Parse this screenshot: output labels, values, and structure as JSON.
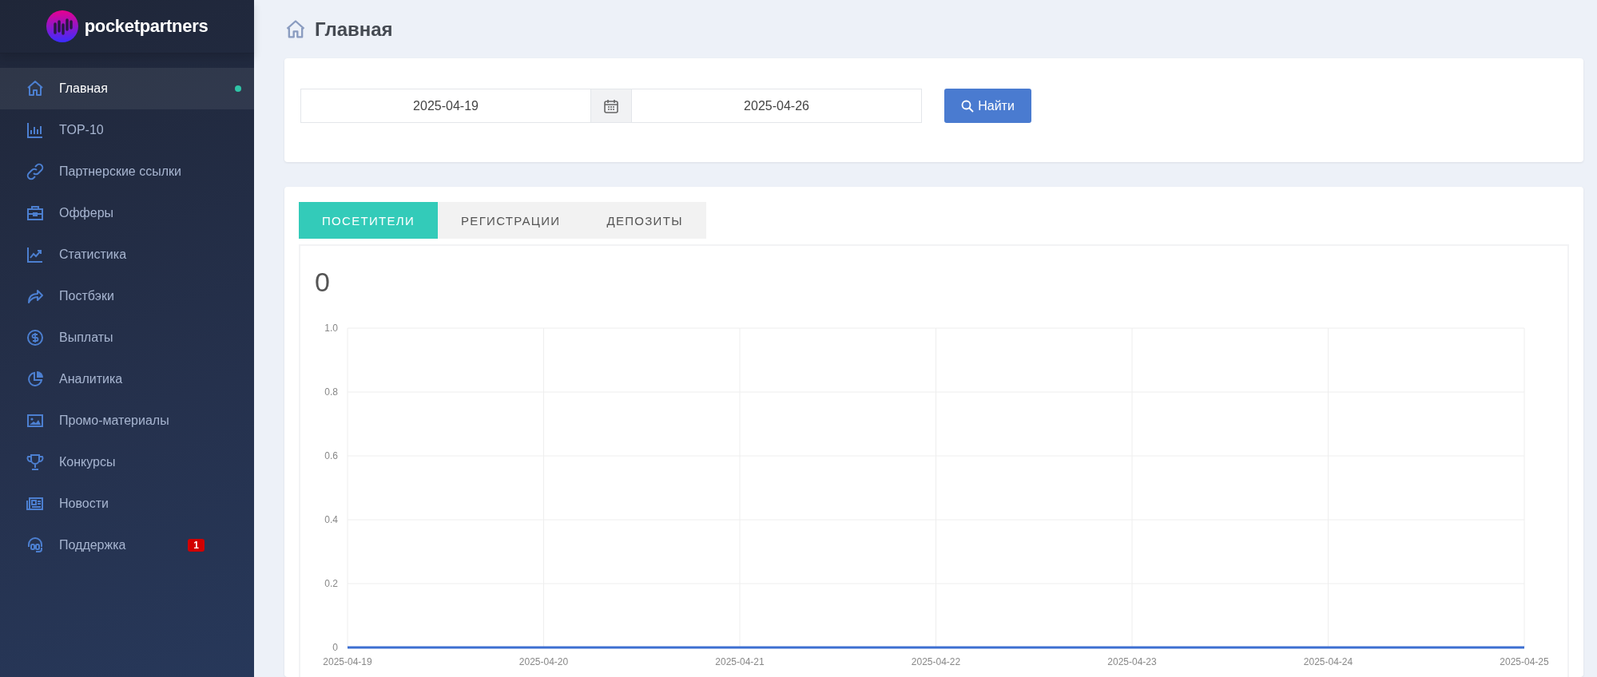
{
  "sidebar": {
    "logo": {
      "text": "pocketpartners"
    },
    "items": [
      {
        "label": "Главная",
        "selected": true
      },
      {
        "label": "TOP-10",
        "selected": false
      },
      {
        "label": "Партнерские ссылки",
        "selected": false
      },
      {
        "label": "Офферы",
        "selected": false
      },
      {
        "label": "Статистика",
        "selected": false
      },
      {
        "label": "Постбэки",
        "selected": false
      },
      {
        "label": "Выплаты",
        "selected": false
      },
      {
        "label": "Аналитика",
        "selected": false
      },
      {
        "label": "Промо-материалы",
        "selected": false
      },
      {
        "label": "Конкурсы",
        "selected": false
      },
      {
        "label": "Новости",
        "selected": false
      },
      {
        "label": "Поддержка",
        "selected": false,
        "badge": "1"
      }
    ]
  },
  "header": {
    "title": "Главная"
  },
  "filter": {
    "date_from": "2025-04-19",
    "date_to": "2025-04-26",
    "button": "Найти"
  },
  "stats": {
    "tabs": [
      {
        "label": "ПОСЕТИТЕЛИ",
        "selected": true
      },
      {
        "label": "РЕГИСТРАЦИИ",
        "selected": false
      },
      {
        "label": "ДЕПОЗИТЫ",
        "selected": false
      }
    ],
    "total": "0",
    "chart_data": {
      "type": "line",
      "categories": [
        "2025-04-19",
        "2025-04-20",
        "2025-04-21",
        "2025-04-22",
        "2025-04-23",
        "2025-04-24",
        "2025-04-25"
      ],
      "series": [
        {
          "color": "#3d6fd1",
          "values": [
            0,
            0,
            0,
            0,
            0,
            0,
            0
          ]
        }
      ],
      "grid": true,
      "ylim": [
        0,
        1
      ],
      "yticks": [
        {
          "value": 0,
          "label": "0"
        },
        {
          "value": 0.2,
          "label": "0.2"
        },
        {
          "value": 0.4,
          "label": "0.4"
        },
        {
          "value": 0.6,
          "label": "0.6"
        },
        {
          "value": 0.8,
          "label": "0.8"
        },
        {
          "value": 1,
          "label": "1.0"
        }
      ]
    }
  }
}
